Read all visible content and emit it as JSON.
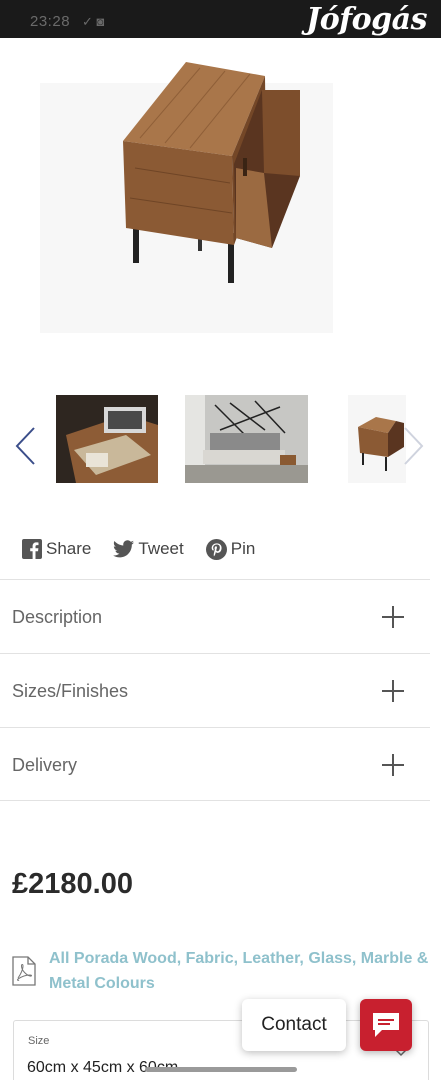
{
  "status_bar": {
    "time": "23:28",
    "icons": "✓ ◙"
  },
  "app": {
    "brand": "Jófogás"
  },
  "gallery": {
    "main_image": "bedside-table-walnut-drawer-open",
    "thumbnails": [
      "walnut-drawer-detail",
      "bedroom-scene",
      "bedside-table-small"
    ],
    "prev_icon": "chevron-left-icon",
    "next_icon": "chevron-right-icon"
  },
  "share": {
    "facebook_label": "Share",
    "twitter_label": "Tweet",
    "pinterest_label": "Pin"
  },
  "accordion": {
    "items": [
      {
        "label": "Description"
      },
      {
        "label": "Sizes/Finishes"
      },
      {
        "label": "Delivery"
      }
    ]
  },
  "product": {
    "price": "£2180.00",
    "colours_link": "All Porada Wood, Fabric, Leather, Glass, Marble & Metal Colours"
  },
  "size_select": {
    "label": "Size",
    "value": "60cm x 45cm x 60cm"
  },
  "contact": {
    "label": "Contact"
  },
  "colors": {
    "accent": "#c8202f",
    "link": "#8fc1cc",
    "status_bar": "#1a1a1a"
  }
}
